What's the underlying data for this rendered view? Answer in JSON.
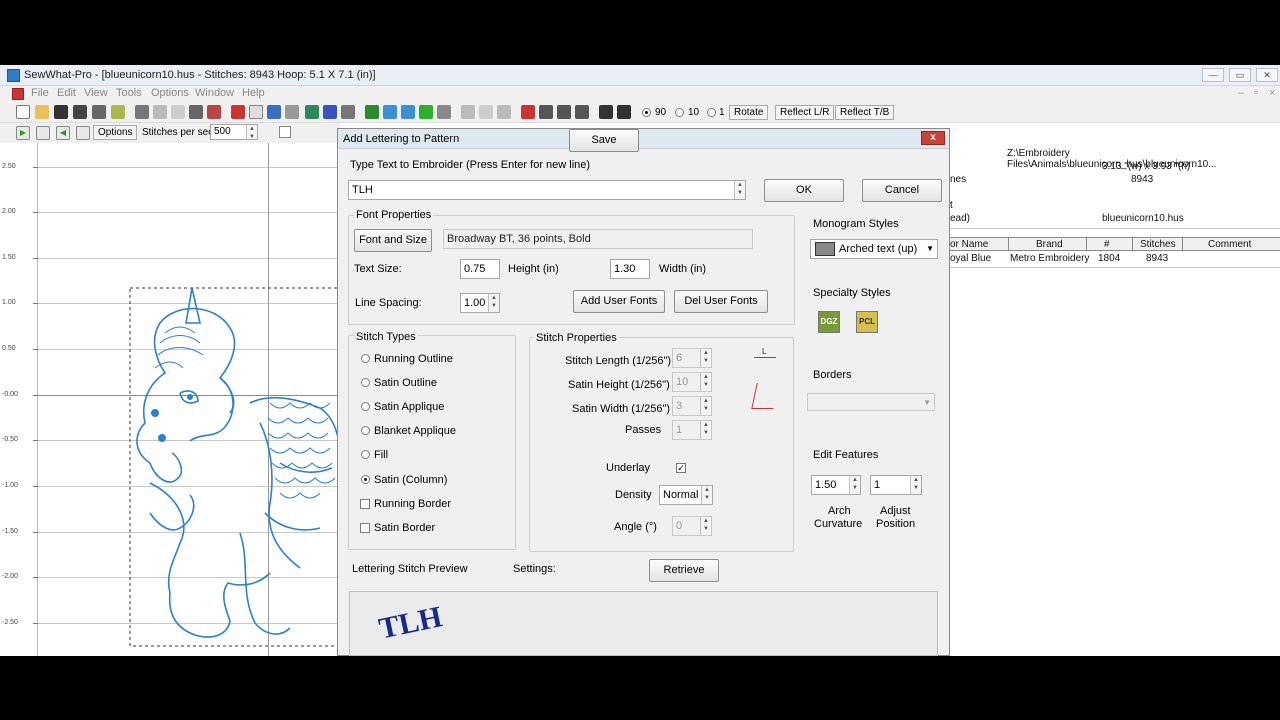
{
  "window": {
    "title": "SewWhat-Pro - [blueunicorn10.hus - Stitches: 8943  Hoop: 5.1 X 7.1 (in)]"
  },
  "menu": [
    "File",
    "Edit",
    "View",
    "Tools",
    "Options",
    "Window",
    "Help"
  ],
  "toolbar": {
    "rotate_values": [
      "90",
      "10",
      "1"
    ],
    "rotate_label": "Rotate",
    "reflect_lr": "Reflect L/R",
    "reflect_tb": "Reflect T/B"
  },
  "toolbar2": {
    "options_label": "Options",
    "stitches_label": "Stitches per sec",
    "stitches_value": "500"
  },
  "ruler": [
    "2.50",
    "2.00",
    "1.50",
    "1.00",
    "0.50",
    "-0.00",
    "-0.50",
    "-1.00",
    "-1.50",
    "-2.00",
    "-2.50"
  ],
  "info": {
    "path": "Z:\\Embroidery Files\\Animals\\blueunicorn_hus\\blueunicorn10...",
    "size": "3.13 \"(w) x 3.93 \"(h)",
    "label_nes": "nes",
    "stitches": "8943",
    "label_t": "t",
    "label_ead": "ead)",
    "filename": "blueunicorn10.hus",
    "table_headers": [
      "or Name",
      "Brand",
      "#",
      "Stitches",
      "Comment"
    ],
    "row": [
      "oyal Blue",
      "Metro Embroidery",
      "1804",
      "8943",
      ""
    ]
  },
  "dialog": {
    "title": "Add Lettering to Pattern",
    "close": "x",
    "type_text_label": "Type Text to Embroider (Press Enter for new line)",
    "text_value": "TLH",
    "ok": "OK",
    "cancel": "Cancel",
    "font_props_label": "Font Properties",
    "font_size_button": "Font and Size",
    "font_value": "Broadway BT, 36 points, Bold",
    "text_size_label": "Text Size:",
    "height_value": "0.75",
    "height_label": "Height (in)",
    "width_value": "1.30",
    "width_label": "Width (in)",
    "line_spacing_label": "Line Spacing:",
    "line_spacing_value": "1.00",
    "add_user_fonts": "Add User Fonts",
    "del_user_fonts": "Del User Fonts",
    "monogram_label": "Monogram Styles",
    "monogram_value": "Arched text (up)",
    "specialty_label": "Specialty Styles",
    "specialty_icons": [
      "DGZ",
      "PCL"
    ],
    "borders_label": "Borders",
    "edit_features_label": "Edit Features",
    "arch_value": "1.50",
    "arch_label1": "Arch",
    "arch_label2": "Curvature",
    "adjust_value": "1",
    "adjust_label1": "Adjust",
    "adjust_label2": "Position",
    "stitch_types_label": "Stitch Types",
    "stitch_types": [
      "Running Outline",
      "Satin Outline",
      "Satin Applique",
      "Blanket Applique",
      "Fill",
      "Satin (Column)",
      "Running Border",
      "Satin Border"
    ],
    "stitch_props_label": "Stitch Properties",
    "stitch_length_label": "Stitch Length (1/256\")",
    "stitch_length_value": "6",
    "satin_height_label": "Satin Height (1/256\")",
    "satin_height_value": "10",
    "satin_width_label": "Satin Width (1/256\")",
    "satin_width_value": "3",
    "passes_label": "Passes",
    "passes_value": "1",
    "underlay_label": "Underlay",
    "underlay_check": "✓",
    "density_label": "Density",
    "density_value": "Normal",
    "angle_label": "Angle (°)",
    "angle_value": "0",
    "preview_label": "Lettering Stitch Preview",
    "settings_label": "Settings:",
    "save": "Save",
    "retrieve": "Retrieve",
    "preview_text": "TLH"
  },
  "colors": {
    "stitch_blue": "#2b7fd4",
    "preview_navy": "#1a2a8c"
  }
}
